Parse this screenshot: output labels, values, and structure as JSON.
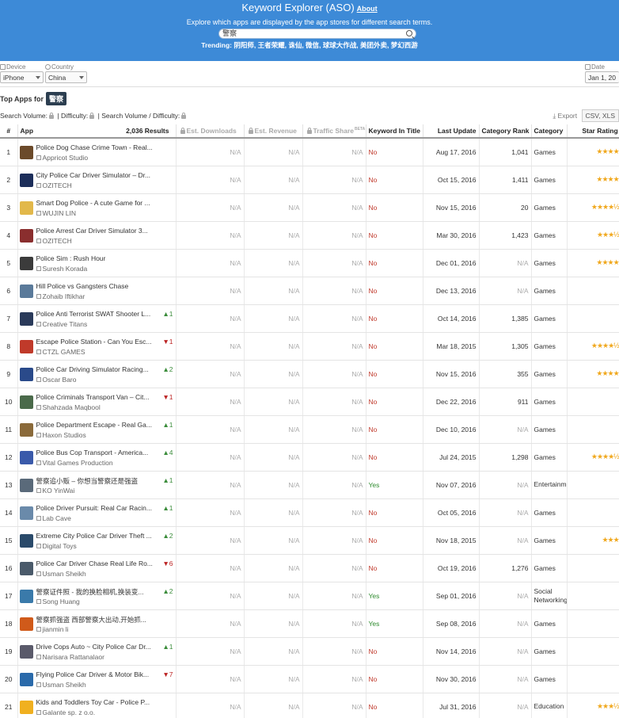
{
  "header": {
    "title": "Keyword Explorer (ASO)",
    "about_link": "About",
    "subtitle": "Explore which apps are displayed by the app stores for different search terms.",
    "search_value": "警察",
    "trending_label": "Trending:",
    "trending_terms": "阴阳师, 王者荣耀, 诛仙, 微信, 球球大作战, 美团外卖, 梦幻西游"
  },
  "filters": {
    "device_label": "Device",
    "device_value": "iPhone",
    "country_label": "Country",
    "country_value": "China",
    "date_label": "Date",
    "date_value": "Jan 1, 20"
  },
  "section": {
    "top_apps_label": "Top Apps for",
    "keyword": "警察",
    "search_volume_label": "Search Volume:",
    "difficulty_label": "| Difficulty:",
    "ratio_label": "| Search Volume / Difficulty:",
    "export_label": "Export",
    "export_format": "CSV, XLS"
  },
  "table": {
    "columns": [
      "#",
      "App",
      "2,036 Results",
      "Est. Downloads",
      "Est. Revenue",
      "Traffic Share",
      "Keyword In Title",
      "Last Update",
      "Category Rank",
      "Category",
      "Star Rating"
    ],
    "traffic_beta": "BETA",
    "rows": [
      {
        "n": "1",
        "name": "Police Dog Chase Crime Town - Real...",
        "dev": "Appricot Studio",
        "chg": "",
        "dir": "",
        "dl": "N/A",
        "rev": "N/A",
        "ts": "N/A",
        "kw": "No",
        "upd": "Aug 17, 2016",
        "rank": "1,041",
        "cat": "Games",
        "stars": "★★★★",
        "rating": "4.0",
        "icon": "#6b4a2a"
      },
      {
        "n": "2",
        "name": "City Police Car Driver Simulator – Dr...",
        "dev": "OZITECH",
        "chg": "",
        "dir": "",
        "dl": "N/A",
        "rev": "N/A",
        "ts": "N/A",
        "kw": "No",
        "upd": "Oct 15, 2016",
        "rank": "1,411",
        "cat": "Games",
        "stars": "★★★★",
        "rating": "4.0",
        "icon": "#1c2e5a"
      },
      {
        "n": "3",
        "name": "Smart Dog Police - A cute Game for ...",
        "dev": "WUJIN LIN",
        "chg": "",
        "dir": "",
        "dl": "N/A",
        "rev": "N/A",
        "ts": "N/A",
        "kw": "No",
        "upd": "Nov 15, 2016",
        "rank": "20",
        "cat": "Games",
        "stars": "★★★★½",
        "rating": "4.5",
        "icon": "#e2b84a"
      },
      {
        "n": "4",
        "name": "Police Arrest Car Driver Simulator 3...",
        "dev": "OZITECH",
        "chg": "",
        "dir": "",
        "dl": "N/A",
        "rev": "N/A",
        "ts": "N/A",
        "kw": "No",
        "upd": "Mar 30, 2016",
        "rank": "1,423",
        "cat": "Games",
        "stars": "★★★½",
        "rating": "3.5",
        "icon": "#8a2e2e"
      },
      {
        "n": "5",
        "name": "Police Sim : Rush Hour",
        "dev": "Suresh Korada",
        "chg": "",
        "dir": "",
        "dl": "N/A",
        "rev": "N/A",
        "ts": "N/A",
        "kw": "No",
        "upd": "Dec 01, 2016",
        "rank": "N/A",
        "cat": "Games",
        "stars": "★★★★",
        "rating": "4.0",
        "icon": "#3b3b3b"
      },
      {
        "n": "6",
        "name": "Hill Police vs Gangsters Chase",
        "dev": "Zohaib Iftikhar",
        "chg": "",
        "dir": "",
        "dl": "N/A",
        "rev": "N/A",
        "ts": "N/A",
        "kw": "No",
        "upd": "Dec 13, 2016",
        "rank": "N/A",
        "cat": "Games",
        "stars": "",
        "rating": "N/A",
        "icon": "#5a7a9a"
      },
      {
        "n": "7",
        "name": "Police Anti Terrorist SWAT Shooter L...",
        "dev": "Creative Titans",
        "chg": "1",
        "dir": "up",
        "dl": "N/A",
        "rev": "N/A",
        "ts": "N/A",
        "kw": "No",
        "upd": "Oct 14, 2016",
        "rank": "1,385",
        "cat": "Games",
        "stars": "",
        "rating": "N/A",
        "icon": "#2a3a5a"
      },
      {
        "n": "8",
        "name": "Escape Police Station - Can You Esc...",
        "dev": "CTZL GAMES",
        "chg": "1",
        "dir": "down",
        "dl": "N/A",
        "rev": "N/A",
        "ts": "N/A",
        "kw": "No",
        "upd": "Mar 18, 2015",
        "rank": "1,305",
        "cat": "Games",
        "stars": "★★★★½",
        "rating": "4.5",
        "icon": "#c03a2a"
      },
      {
        "n": "9",
        "name": "Police Car Driving Simulator Racing...",
        "dev": "Oscar Baro",
        "chg": "2",
        "dir": "up",
        "dl": "N/A",
        "rev": "N/A",
        "ts": "N/A",
        "kw": "No",
        "upd": "Nov 15, 2016",
        "rank": "355",
        "cat": "Games",
        "stars": "★★★★",
        "rating": "4.0",
        "icon": "#2a4a8a"
      },
      {
        "n": "10",
        "name": "Police Criminals Transport Van – Cit...",
        "dev": "Shahzada Maqbool",
        "chg": "1",
        "dir": "down",
        "dl": "N/A",
        "rev": "N/A",
        "ts": "N/A",
        "kw": "No",
        "upd": "Dec 22, 2016",
        "rank": "911",
        "cat": "Games",
        "stars": "",
        "rating": "N/A",
        "icon": "#4a6a4a"
      },
      {
        "n": "11",
        "name": "Police Department Escape - Real Ga...",
        "dev": "Haxon Studios",
        "chg": "1",
        "dir": "up",
        "dl": "N/A",
        "rev": "N/A",
        "ts": "N/A",
        "kw": "No",
        "upd": "Dec 10, 2016",
        "rank": "N/A",
        "cat": "Games",
        "stars": "",
        "rating": "N/A",
        "icon": "#8a6a3a"
      },
      {
        "n": "12",
        "name": "Police Bus Cop Transport - America...",
        "dev": "Vital Games Production",
        "chg": "4",
        "dir": "up",
        "dl": "N/A",
        "rev": "N/A",
        "ts": "N/A",
        "kw": "No",
        "upd": "Jul 24, 2015",
        "rank": "1,298",
        "cat": "Games",
        "stars": "★★★★½",
        "rating": "4.5",
        "icon": "#3a5aaa"
      },
      {
        "n": "13",
        "name": "警察追小贩 – 你想当警察还是强盗",
        "dev": "KO YinWai",
        "chg": "1",
        "dir": "up",
        "dl": "N/A",
        "rev": "N/A",
        "ts": "N/A",
        "kw": "Yes",
        "upd": "Nov 07, 2016",
        "rank": "N/A",
        "cat": "Entertainment",
        "stars": "",
        "rating": "N/A",
        "icon": "#5a6a7a"
      },
      {
        "n": "14",
        "name": "Police Driver Pursuit: Real Car Racin...",
        "dev": "Lab Cave",
        "chg": "1",
        "dir": "up",
        "dl": "N/A",
        "rev": "N/A",
        "ts": "N/A",
        "kw": "No",
        "upd": "Oct 05, 2016",
        "rank": "N/A",
        "cat": "Games",
        "stars": "",
        "rating": "N/A",
        "icon": "#6a8aaa"
      },
      {
        "n": "15",
        "name": "Extreme City Police Car Driver Theft ...",
        "dev": "Digital Toys",
        "chg": "2",
        "dir": "up",
        "dl": "N/A",
        "rev": "N/A",
        "ts": "N/A",
        "kw": "No",
        "upd": "Nov 18, 2015",
        "rank": "N/A",
        "cat": "Games",
        "stars": "★★★",
        "rating": "3.0",
        "icon": "#2a4a6a"
      },
      {
        "n": "16",
        "name": "Police Car Driver Chase Real Life Ro...",
        "dev": "Usman Sheikh",
        "chg": "6",
        "dir": "down",
        "dl": "N/A",
        "rev": "N/A",
        "ts": "N/A",
        "kw": "No",
        "upd": "Oct 19, 2016",
        "rank": "1,276",
        "cat": "Games",
        "stars": "",
        "rating": "N/A",
        "icon": "#4a5a6a"
      },
      {
        "n": "17",
        "name": "警察证件照 - 我的换脸相机,换装变...",
        "dev": "Song Huang",
        "chg": "2",
        "dir": "up",
        "dl": "N/A",
        "rev": "N/A",
        "ts": "N/A",
        "kw": "Yes",
        "upd": "Sep 01, 2016",
        "rank": "N/A",
        "cat": "Social Networking",
        "stars": "",
        "rating": "N/A",
        "icon": "#3a7aaa"
      },
      {
        "n": "18",
        "name": "警察抓强盗 西部警察大出动,开始抓...",
        "dev": "jianmin li",
        "chg": "",
        "dir": "",
        "dl": "N/A",
        "rev": "N/A",
        "ts": "N/A",
        "kw": "Yes",
        "upd": "Sep 08, 2016",
        "rank": "N/A",
        "cat": "Games",
        "stars": "",
        "rating": "N/A",
        "icon": "#d05a1a"
      },
      {
        "n": "19",
        "name": "Drive Cops Auto ~ City Police Car Dr...",
        "dev": "Narisara Rattanalaor",
        "chg": "1",
        "dir": "up",
        "dl": "N/A",
        "rev": "N/A",
        "ts": "N/A",
        "kw": "No",
        "upd": "Nov 14, 2016",
        "rank": "N/A",
        "cat": "Games",
        "stars": "",
        "rating": "N/A",
        "icon": "#5a5a6a"
      },
      {
        "n": "20",
        "name": "Flying Police Car Driver & Motor Bik...",
        "dev": "Usman Sheikh",
        "chg": "7",
        "dir": "down",
        "dl": "N/A",
        "rev": "N/A",
        "ts": "N/A",
        "kw": "No",
        "upd": "Nov 30, 2016",
        "rank": "N/A",
        "cat": "Games",
        "stars": "",
        "rating": "N/A",
        "icon": "#2a6aaa"
      },
      {
        "n": "21",
        "name": "Kids and Toddlers Toy Car - Police P...",
        "dev": "Galante sp. z o.o.",
        "chg": "",
        "dir": "",
        "dl": "N/A",
        "rev": "N/A",
        "ts": "N/A",
        "kw": "No",
        "upd": "Jul 31, 2016",
        "rank": "N/A",
        "cat": "Education",
        "stars": "★★★½",
        "rating": "3.5",
        "icon": "#f0b020"
      }
    ]
  }
}
